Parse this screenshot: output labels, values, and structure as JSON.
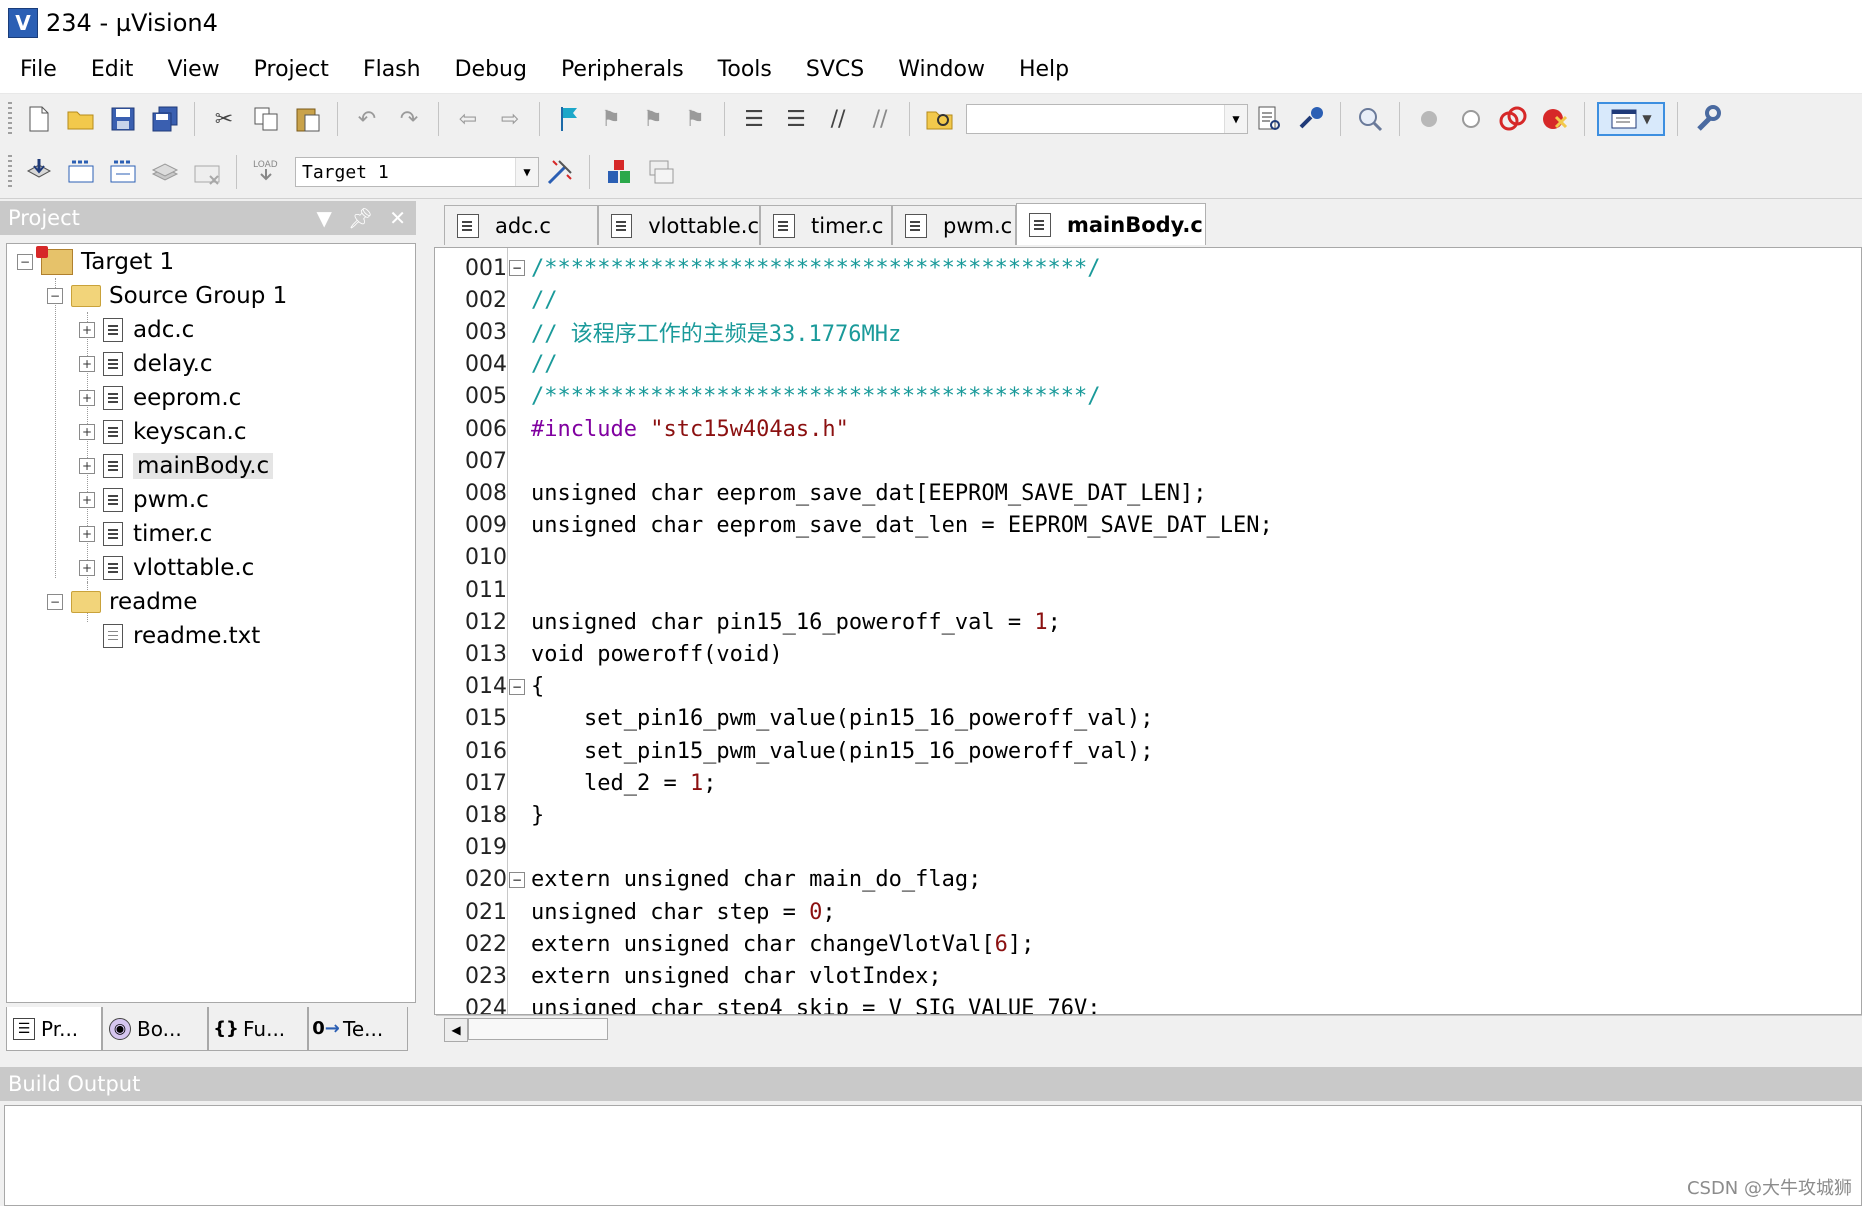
{
  "window": {
    "title": "234  - µVision4",
    "icon_name": "uvision-app-icon"
  },
  "menu": [
    "File",
    "Edit",
    "View",
    "Project",
    "Flash",
    "Debug",
    "Peripherals",
    "Tools",
    "SVCS",
    "Window",
    "Help"
  ],
  "toolbar2": {
    "target_select": "Target 1"
  },
  "project_pane": {
    "title": "Project",
    "tree": {
      "target": "Target 1",
      "group1": "Source Group 1",
      "files": [
        "adc.c",
        "delay.c",
        "eeprom.c",
        "keyscan.c",
        "mainBody.c",
        "pwm.c",
        "timer.c",
        "vlottable.c"
      ],
      "group2": "readme",
      "readme_file": "readme.txt",
      "selected": "mainBody.c"
    },
    "bottom_tabs": [
      "Pr...",
      "Bo...",
      "Fu...",
      "Te..."
    ]
  },
  "editor": {
    "tabs": [
      "adc.c",
      "vlottable.c",
      "timer.c",
      "pwm.c",
      "mainBody.c"
    ],
    "active_tab": "mainBody.c",
    "lines": [
      {
        "n": "001",
        "fold": "minus",
        "parts": [
          [
            "c",
            "/*****************************************/"
          ]
        ]
      },
      {
        "n": "002",
        "parts": [
          [
            "c",
            "//"
          ]
        ]
      },
      {
        "n": "003",
        "parts": [
          [
            "c",
            "// 该程序工作的主频是33.1776MHz"
          ]
        ]
      },
      {
        "n": "004",
        "parts": [
          [
            "c",
            "//"
          ]
        ]
      },
      {
        "n": "005",
        "parts": [
          [
            "c",
            "/*****************************************/"
          ]
        ]
      },
      {
        "n": "006",
        "parts": [
          [
            "p",
            "#include "
          ],
          [
            "s",
            "\"stc15w404as.h\""
          ]
        ]
      },
      {
        "n": "007",
        "parts": []
      },
      {
        "n": "008",
        "parts": [
          [
            "k",
            "unsigned char eeprom_save_dat[EEPROM_SAVE_DAT_LEN];"
          ]
        ]
      },
      {
        "n": "009",
        "parts": [
          [
            "k",
            "unsigned char eeprom_save_dat_len = EEPROM_SAVE_DAT_LEN;"
          ]
        ]
      },
      {
        "n": "010",
        "parts": []
      },
      {
        "n": "011",
        "parts": []
      },
      {
        "n": "012",
        "parts": [
          [
            "k",
            "unsigned char pin15_16_poweroff_val = "
          ],
          [
            "n",
            "1"
          ],
          [
            "k",
            ";"
          ]
        ]
      },
      {
        "n": "013",
        "parts": [
          [
            "k",
            "void poweroff(void)"
          ]
        ]
      },
      {
        "n": "014",
        "fold": "minus",
        "parts": [
          [
            "k",
            "{"
          ]
        ]
      },
      {
        "n": "015",
        "parts": [
          [
            "k",
            "    set_pin16_pwm_value(pin15_16_poweroff_val);"
          ]
        ]
      },
      {
        "n": "016",
        "parts": [
          [
            "k",
            "    set_pin15_pwm_value(pin15_16_poweroff_val);"
          ]
        ]
      },
      {
        "n": "017",
        "parts": [
          [
            "k",
            "    led_2 = "
          ],
          [
            "n",
            "1"
          ],
          [
            "k",
            ";"
          ]
        ]
      },
      {
        "n": "018",
        "parts": [
          [
            "k",
            "}"
          ]
        ]
      },
      {
        "n": "019",
        "parts": []
      },
      {
        "n": "020",
        "fold": "minus",
        "parts": [
          [
            "k",
            "extern unsigned char main_do_flag;"
          ]
        ]
      },
      {
        "n": "021",
        "parts": [
          [
            "k",
            "unsigned char step = "
          ],
          [
            "n",
            "0"
          ],
          [
            "k",
            ";"
          ]
        ]
      },
      {
        "n": "022",
        "parts": [
          [
            "k",
            "extern unsigned char changeVlotVal["
          ],
          [
            "n",
            "6"
          ],
          [
            "k",
            "];"
          ]
        ]
      },
      {
        "n": "023",
        "parts": [
          [
            "k",
            "extern unsigned char vlotIndex;"
          ]
        ]
      },
      {
        "n": "024",
        "parts": [
          [
            "k",
            "unsigned char step4_skip = V_SIG_VALUE_76V;"
          ]
        ]
      }
    ]
  },
  "build_output": {
    "title": "Build Output"
  },
  "watermark": "CSDN @大牛攻城狮",
  "colors": {
    "comment": "#1a9a9a",
    "preprocessor": "#8000a0",
    "string": "#8b1010",
    "number": "#8b1010"
  }
}
